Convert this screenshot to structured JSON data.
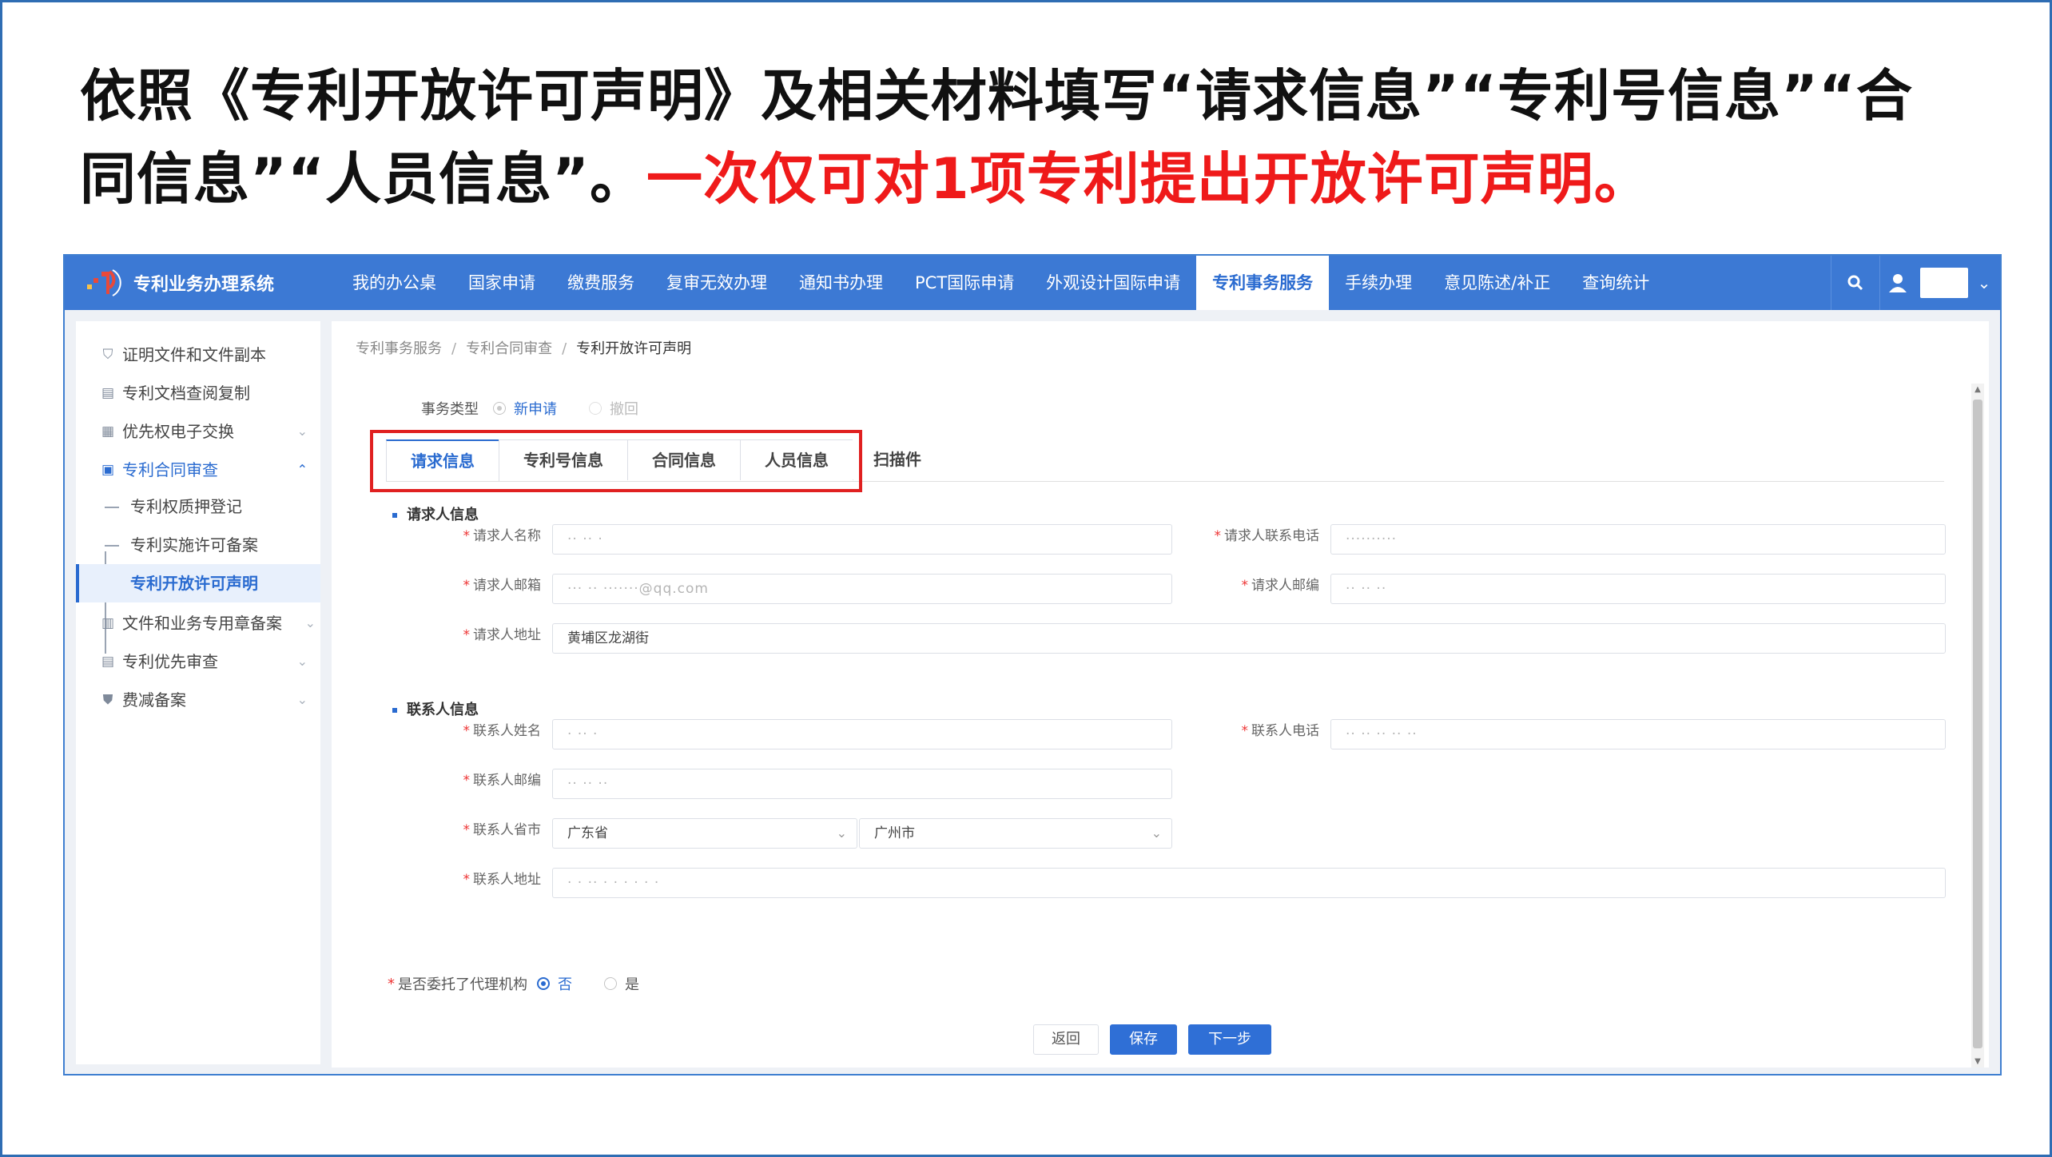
{
  "heading": {
    "line1": "依照《专利开放许可声明》及相关材料填写“请求信息”“专利号信息”“合",
    "line2_black": "同信息”“人员信息”。",
    "line2_red": "一次仅可对1项专利提出开放许可声明。"
  },
  "app": {
    "logo_text": "专利业务办理系统",
    "nav": [
      "我的办公桌",
      "国家申请",
      "缴费服务",
      "复审无效办理",
      "通知书办理",
      "PCT国际申请",
      "外观设计国际申请",
      "专利事务服务",
      "手续办理",
      "意见陈述/补正",
      "查询统计"
    ],
    "nav_active": "专利事务服务",
    "sidebar": {
      "cert": "证明文件和文件副本",
      "archive": "专利文档查阅复制",
      "priority_exchange": "优先权电子交换",
      "contract_review": "专利合同审查",
      "pledge": "专利权质押登记",
      "license_filing": "专利实施许可备案",
      "open_license": "专利开放许可声明",
      "seal_filing": "文件和业务专用章备案",
      "priority_review": "专利优先审查",
      "fee_reduction": "费减备案"
    },
    "breadcrumb": [
      "专利事务服务",
      "专利合同审查",
      "专利开放许可声明"
    ],
    "breadcrumb_sep": "/",
    "business_type": {
      "label": "事务类型",
      "option1": "新申请",
      "option2": "撤回"
    },
    "tabs": [
      "请求信息",
      "专利号信息",
      "合同信息",
      "人员信息",
      "扫描件"
    ],
    "requester": {
      "section": "请求人信息",
      "name_label": "请求人名称",
      "name_value": "·· ·· ·",
      "phone_label": "请求人联系电话",
      "phone_value": "··········",
      "email_label": "请求人邮箱",
      "email_value": "··· ·· ·······@qq.com",
      "zip_label": "请求人邮编",
      "zip_value": "·· ·· ··",
      "address_label": "请求人地址",
      "address_value": "黄埔区龙湖街"
    },
    "contact": {
      "section": "联系人信息",
      "name_label": "联系人姓名",
      "name_value": "· ·· ·",
      "phone_label": "联系人电话",
      "phone_value": "·· ·· ·· ·· ··",
      "zip_label": "联系人邮编",
      "zip_value": "·· ·· ··",
      "city_label": "联系人省市",
      "province_value": "广东省",
      "city_value": "广州市",
      "address_label": "联系人地址",
      "address_value": "· · ·· · · · · ·   ·"
    },
    "agency": {
      "label": "是否委托了代理机构",
      "no": "否",
      "yes": "是"
    },
    "buttons": {
      "back": "返回",
      "save": "保存",
      "next": "下一步"
    },
    "required_mark": "*"
  },
  "colors": {
    "nav_blue": "#3c79d4",
    "accent": "#2a6bd0",
    "highlight_red": "#e02020",
    "heading_red": "#ef1a1a"
  }
}
